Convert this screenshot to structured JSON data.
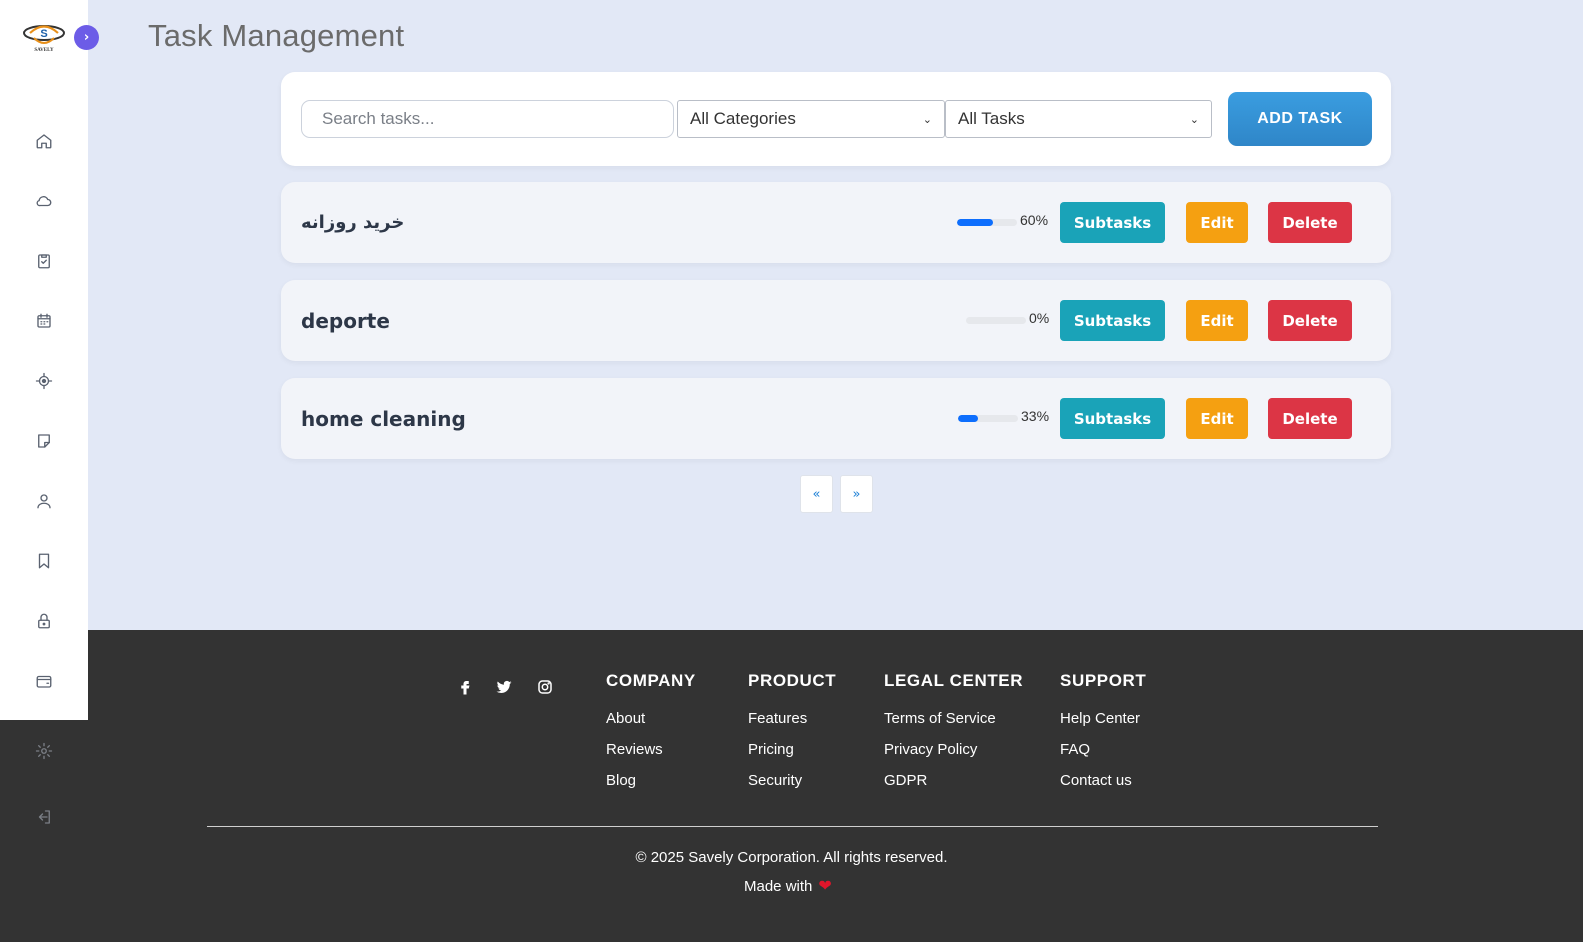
{
  "app": {
    "logo_text": "SAVELY",
    "title": "Task Management"
  },
  "toolbar": {
    "search_placeholder": "Search tasks...",
    "category_select": "All Categories",
    "filter_select": "All Tasks",
    "add_label": "ADD TASK"
  },
  "tasks": [
    {
      "name": "خرید روزانه",
      "progress": 60,
      "progress_label": "60%",
      "subtasks_label": "Subtasks",
      "edit_label": "Edit",
      "delete_label": "Delete"
    },
    {
      "name": "deporte",
      "progress": 0,
      "progress_label": "0%",
      "subtasks_label": "Subtasks",
      "edit_label": "Edit",
      "delete_label": "Delete"
    },
    {
      "name": "home cleaning",
      "progress": 33,
      "progress_label": "33%",
      "subtasks_label": "Subtasks",
      "edit_label": "Edit",
      "delete_label": "Delete"
    }
  ],
  "pagination": {
    "prev": "«",
    "next": "»"
  },
  "sidebar": {
    "icons": [
      "home-icon",
      "cloud-icon",
      "clipboard-check-icon",
      "calendar-icon",
      "target-icon",
      "sticky-note-icon",
      "user-icon",
      "bookmark-icon",
      "lock-icon",
      "wallet-icon",
      "gear-icon",
      "logout-icon"
    ]
  },
  "footer": {
    "columns": [
      {
        "heading": "COMPANY",
        "links": [
          "About",
          "Reviews",
          "Blog"
        ]
      },
      {
        "heading": "PRODUCT",
        "links": [
          "Features",
          "Pricing",
          "Security"
        ]
      },
      {
        "heading": "LEGAL CENTER",
        "links": [
          "Terms of Service",
          "Privacy Policy",
          "GDPR"
        ]
      },
      {
        "heading": "SUPPORT",
        "links": [
          "Help Center",
          "FAQ",
          "Contact us"
        ]
      }
    ],
    "copyright": "© 2025 Savely Corporation. All rights reserved.",
    "made_with": "Made with"
  },
  "colors": {
    "accent": "#6c5ce7",
    "primary_button": "#2f86c8",
    "subtasks": "#1aa3b8",
    "edit": "#f5a011",
    "delete": "#dc3545",
    "progress": "#0d6efd",
    "footer_bg": "#333333"
  }
}
